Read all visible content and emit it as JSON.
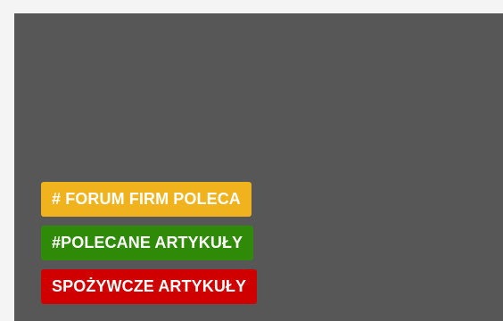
{
  "tags": [
    {
      "label": "# FORUM FIRM POLECA",
      "color": "#f0b31e"
    },
    {
      "label": "#POLECANE ARTYKUŁY",
      "color": "#2f8a07"
    },
    {
      "label": "SPOŻYWCZE ARTYKUŁY",
      "color": "#d00000"
    }
  ]
}
